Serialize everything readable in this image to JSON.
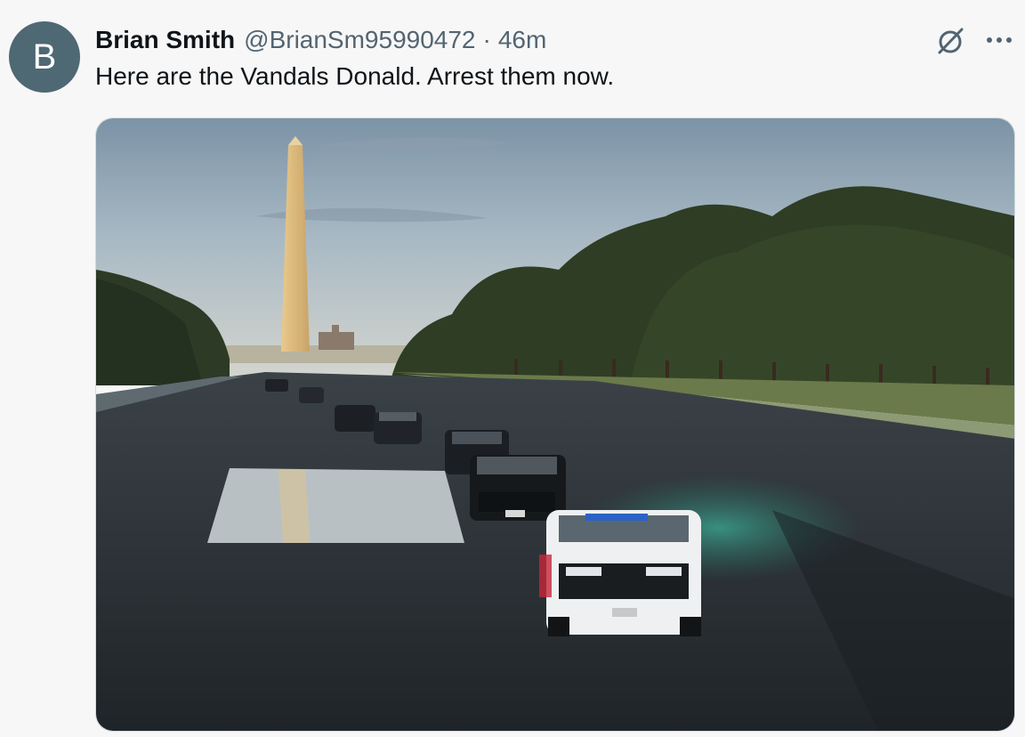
{
  "author": {
    "avatar_letter": "B",
    "display_name": "Brian Smith",
    "handle": "@BrianSm95990472",
    "separator": "·",
    "timestamp": "46m"
  },
  "tweet": {
    "text": "Here are the Vandals Donald. Arrest them now."
  },
  "icons": {
    "grok": "grok-slash-circle-icon",
    "more": "more-dots-icon"
  },
  "media": {
    "type": "photo",
    "alt": ""
  },
  "colors": {
    "avatar_bg": "#4e6874",
    "text_primary": "#0f1419",
    "text_secondary": "#536471",
    "background": "#f7f7f7"
  }
}
